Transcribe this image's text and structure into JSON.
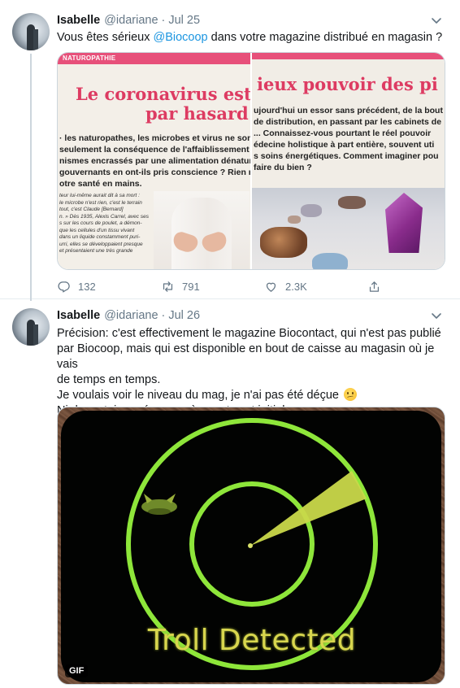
{
  "tweets": [
    {
      "author": {
        "name": "Isabelle",
        "handle": "@idariane"
      },
      "date": "Jul 25",
      "text_before": "Vous êtes sérieux ",
      "mention": "@Biocoop",
      "text_after": " dans votre magazine distribué en magasin ?",
      "media": {
        "banner": "NATUROPATHIE",
        "left_headline_1": "Le coronavirus est",
        "left_headline_2": "par hasard",
        "right_headline": "ieux pouvoir des pi",
        "left_copy": [
          "· les naturopathes, les microbes et virus ne sont pas",
          "seulement la conséquence de l'affaiblissement de",
          "nismes encrassés par une alimentation dénaturée e",
          "gouvernants en ont-ils pris conscience ? Rien n'est",
          "otre santé en mains."
        ],
        "left_small": [
          "teur lui-même aurait dit à sa mort :",
          "le microbe n'est rien, c'est le terrain",
          "tout, c'est Claude [Bernard]",
          "n. » Dès 1935, Alexis Carrel, avec ses",
          "s sur les cours de poulet, a démon-",
          "que les cellules d'un tissu vivant",
          "dans un liquide constamment puri-",
          "urri, elles se développaient presque",
          "et présentaient une très grande"
        ],
        "right_copy": [
          "ujourd'hui un essor sans précédent, de la bout",
          "de distribution, en passant par les cabinets de",
          "... Connaissez-vous pourtant le réel pouvoir",
          "édecine holistique à part entière, souvent uti",
          "s soins énergétiques. Comment imaginer pou",
          "faire du bien ?"
        ]
      },
      "stats": {
        "replies": "132",
        "retweets": "791",
        "likes": "2.3K"
      }
    },
    {
      "author": {
        "name": "Isabelle",
        "handle": "@idariane"
      },
      "date": "Jul 26",
      "lines": [
        "Précision: c'est effectivement le magazine Biocontact, qui n'est pas publié",
        "par Biocoop, mais qui est disponible en bout de caisse au magasin où je vais",
        "de temps en temps.",
        "Je voulais voir le niveau du mag, je n'ai pas été déçue",
        "Ni de certaines réponses à mon tweet initial..."
      ],
      "gif": {
        "caption": "Troll Detected",
        "badge": "GIF"
      }
    }
  ],
  "header": {
    "separator": "·"
  },
  "colors": {
    "link": "#1b95e0",
    "muted": "#657786",
    "radar": "#8ee63a"
  },
  "icons": [
    "caret-down-icon",
    "reply-icon",
    "retweet-icon",
    "like-icon",
    "share-icon",
    "worried-face-emoji"
  ]
}
